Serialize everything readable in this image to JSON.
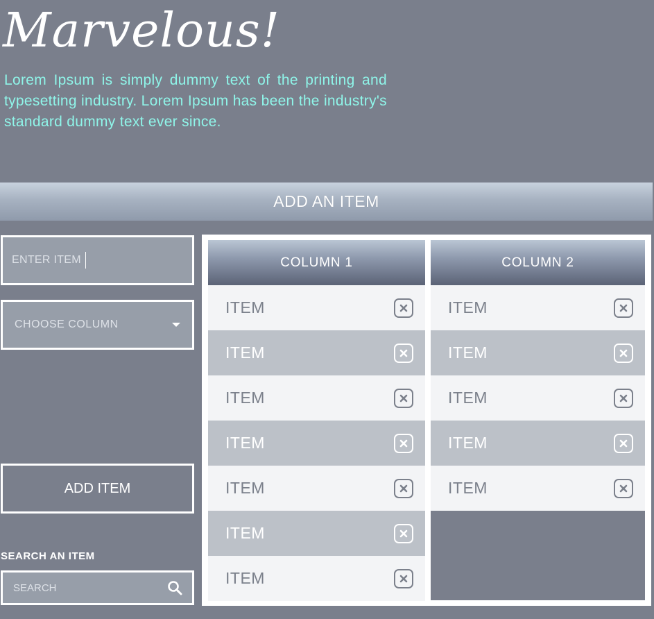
{
  "header": {
    "title": "Marvelous!",
    "intro": "Lorem Ipsum is simply dummy text of the printing and typesetting industry. Lorem Ipsum has been the industry's standard dummy text ever since."
  },
  "banner": {
    "label": "ADD AN ITEM"
  },
  "form": {
    "item_placeholder": "ENTER ITEM",
    "column_placeholder": "CHOOSE COLUMN",
    "add_button_label": "ADD ITEM",
    "search_label": "SEARCH AN ITEM",
    "search_placeholder": "SEARCH"
  },
  "columns": [
    {
      "title": "COLUMN 1",
      "items": [
        "ITEM",
        "ITEM",
        "ITEM",
        "ITEM",
        "ITEM",
        "ITEM",
        "ITEM"
      ]
    },
    {
      "title": "COLUMN 2",
      "items": [
        "ITEM",
        "ITEM",
        "ITEM",
        "ITEM",
        "ITEM"
      ]
    }
  ],
  "icons": {
    "remove": "close-icon",
    "search": "search-icon",
    "dropdown": "chevron-down-icon"
  },
  "colors": {
    "background": "#7a7f8c",
    "accent_text": "#8ff5e9",
    "row_light": "#f3f4f6",
    "row_dark": "#bcc1c8"
  }
}
